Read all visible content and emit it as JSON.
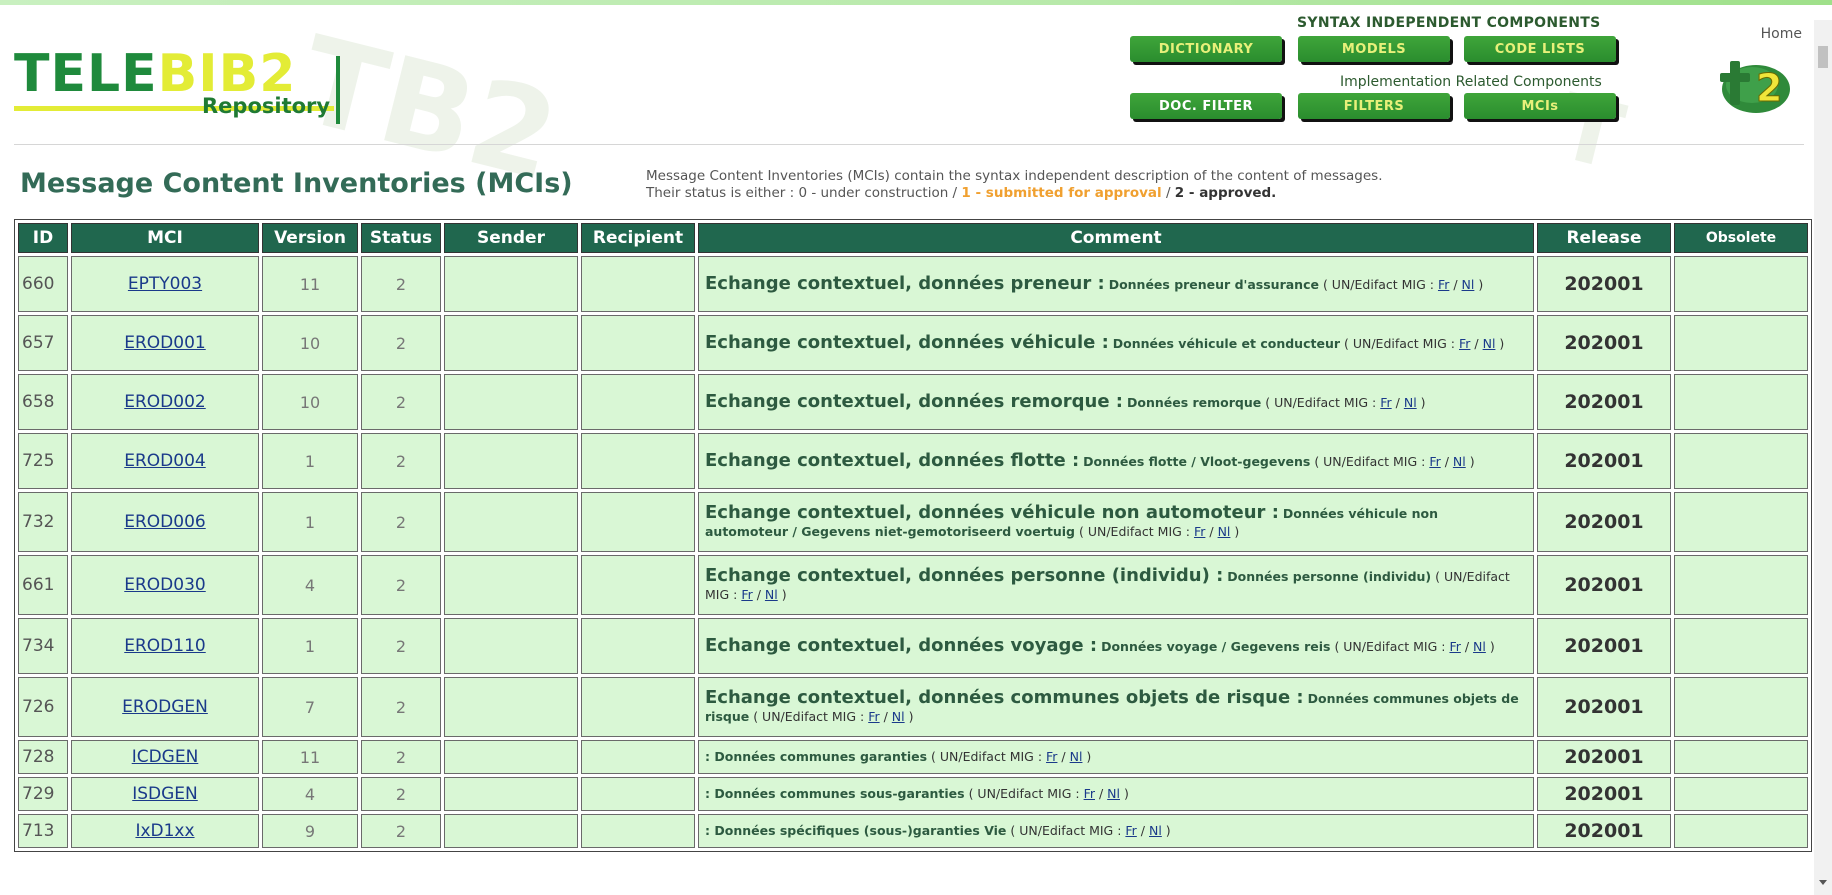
{
  "header": {
    "logo_main_a": "TELE",
    "logo_main_b": "BIB2",
    "logo_sub": "Repository",
    "home_label": "Home",
    "syntax_title": "SYNTAX INDEPENDENT COMPONENTS",
    "impl_title": "Implementation Related Components",
    "nav_top": [
      {
        "label": "DICTIONARY",
        "style": "yellow"
      },
      {
        "label": "MODELS",
        "style": "yellow"
      },
      {
        "label": "CODE LISTS",
        "style": "yellow"
      }
    ],
    "nav_bottom": [
      {
        "label": "DOC. FILTER",
        "style": "white"
      },
      {
        "label": "FILTERS",
        "style": "yellow"
      },
      {
        "label": "MCIs",
        "style": "yellow"
      }
    ]
  },
  "page": {
    "title": "Message Content Inventories (MCIs)",
    "intro_line1": "Message Content Inventories (MCIs) contain the syntax independent description of the content of messages.",
    "intro_line2_a": "Their status is either : 0 - under construction / ",
    "intro_line2_b": "1 - submitted for approval",
    "intro_line2_c": " / ",
    "intro_line2_d": "2 - approved.",
    "columns": [
      "ID",
      "MCI",
      "Version",
      "Status",
      "Sender",
      "Recipient",
      "Comment",
      "Release",
      "Obsolete"
    ],
    "rows": [
      {
        "id": "660",
        "mci": "EPTY003",
        "version": "11",
        "status": "2",
        "title": "Echange contextuel, données preneur :",
        "desc": "Données preneur d'assurance",
        "release": "202001"
      },
      {
        "id": "657",
        "mci": "EROD001",
        "version": "10",
        "status": "2",
        "title": "Echange contextuel, données véhicule :",
        "desc": "Données véhicule et conducteur",
        "release": "202001"
      },
      {
        "id": "658",
        "mci": "EROD002",
        "version": "10",
        "status": "2",
        "title": "Echange contextuel, données remorque :",
        "desc": "Données remorque",
        "release": "202001"
      },
      {
        "id": "725",
        "mci": "EROD004",
        "version": "1",
        "status": "2",
        "title": "Echange contextuel, données flotte :",
        "desc": "Données flotte / Vloot-gegevens",
        "release": "202001"
      },
      {
        "id": "732",
        "mci": "EROD006",
        "version": "1",
        "status": "2",
        "title": "Echange contextuel, données véhicule non automoteur :",
        "desc": "Données véhicule non automoteur / Gegevens niet-gemotoriseerd voertuig",
        "release": "202001"
      },
      {
        "id": "661",
        "mci": "EROD030",
        "version": "4",
        "status": "2",
        "title": "Echange contextuel, données personne (individu) :",
        "desc": "Données personne (individu)",
        "release": "202001"
      },
      {
        "id": "734",
        "mci": "EROD110",
        "version": "1",
        "status": "2",
        "title": "Echange contextuel, données voyage :",
        "desc": "Données voyage / Gegevens reis",
        "release": "202001"
      },
      {
        "id": "726",
        "mci": "ERODGEN",
        "version": "7",
        "status": "2",
        "title": "Echange contextuel, données communes objets de risque :",
        "desc": "Données communes objets de risque",
        "release": "202001"
      },
      {
        "id": "728",
        "mci": "ICDGEN",
        "version": "11",
        "status": "2",
        "title": "",
        "desc": ": Données communes garanties",
        "release": "202001"
      },
      {
        "id": "729",
        "mci": "ISDGEN",
        "version": "4",
        "status": "2",
        "title": "",
        "desc": ": Données communes sous-garanties",
        "release": "202001"
      },
      {
        "id": "713",
        "mci": "IxD1xx",
        "version": "9",
        "status": "2",
        "title": "",
        "desc": ": Données spécifiques (sous-)garanties Vie",
        "release": "202001"
      }
    ],
    "mig_open": "( UN/Edifact MIG : ",
    "mig_fr": "Fr",
    "mig_sep": " / ",
    "mig_nl": "Nl",
    "mig_close": " )"
  },
  "colors": {
    "brand_green": "#1f8a3c",
    "brand_yellow": "#e3ec36",
    "header_cell": "#20674e",
    "row_cell": "#d9f7d5",
    "title_text": "#336b57",
    "approval_orange": "#f0a030"
  }
}
